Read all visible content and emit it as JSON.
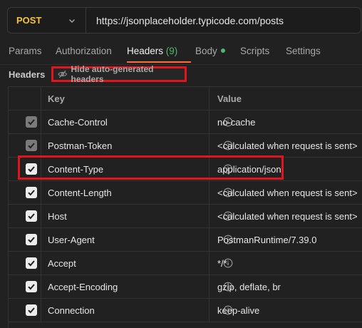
{
  "request": {
    "method": "POST",
    "url": "https://jsonplaceholder.typicode.com/posts"
  },
  "tabs": [
    {
      "label": "Params"
    },
    {
      "label": "Authorization"
    },
    {
      "label": "Headers",
      "count": "(9)"
    },
    {
      "label": "Body"
    },
    {
      "label": "Scripts"
    },
    {
      "label": "Settings"
    }
  ],
  "headers_section": {
    "title": "Headers",
    "hide_button": "Hide auto-generated headers"
  },
  "table": {
    "columns": [
      "Key",
      "Value"
    ],
    "rows": [
      {
        "key": "Cache-Control",
        "value": "no-cache",
        "checked": true,
        "dimmed": true
      },
      {
        "key": "Postman-Token",
        "value": "<calculated when request is sent>",
        "checked": true,
        "dimmed": true
      },
      {
        "key": "Content-Type",
        "value": "application/json",
        "checked": true,
        "dimmed": false
      },
      {
        "key": "Content-Length",
        "value": "<calculated when request is sent>",
        "checked": true,
        "dimmed": false
      },
      {
        "key": "Host",
        "value": "<calculated when request is sent>",
        "checked": true,
        "dimmed": false
      },
      {
        "key": "User-Agent",
        "value": "PostmanRuntime/7.39.0",
        "checked": true,
        "dimmed": false
      },
      {
        "key": "Accept",
        "value": "*/*",
        "checked": true,
        "dimmed": false
      },
      {
        "key": "Accept-Encoding",
        "value": "gzip, deflate, br",
        "checked": true,
        "dimmed": false
      },
      {
        "key": "Connection",
        "value": "keep-alive",
        "checked": true,
        "dimmed": false
      }
    ]
  },
  "colors": {
    "method": "#f5c242",
    "accent": "#ff6c37",
    "count": "#4cb86f",
    "highlight": "#e0161f"
  }
}
